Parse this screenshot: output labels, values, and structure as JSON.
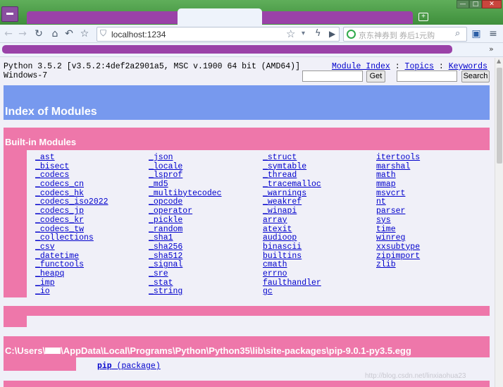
{
  "browser": {
    "new_tab": "+",
    "window_buttons": {
      "minimize": "—",
      "maximize": "□",
      "close": "✕"
    },
    "nav_icons": {
      "back": "←",
      "forward": "→",
      "reload": "↻",
      "home": "⌂",
      "undo": "↶",
      "favorite": "☆"
    },
    "address": {
      "url": "localhost:1234",
      "shield_icon": "⛉"
    },
    "address_icons": {
      "bookmark": "☆",
      "dropdown": "▾",
      "lightning": "ϟ",
      "play": "▶"
    },
    "search": {
      "placeholder": "京东神券到 券后1元购",
      "glass_icon": "⌕"
    },
    "extension_icon": "▣",
    "menu_icon": "≡",
    "bookmarks_more": "»",
    "scroll_up": "▲"
  },
  "header": {
    "version_line_1": "Python 3.5.2 [v3.5.2:4def2a2901a5, MSC v.1900 64 bit (AMD64)]",
    "version_line_2": "Windows-7",
    "links": {
      "module_index": "Module Index",
      "topics": "Topics",
      "keywords": "Keywords",
      "separator": " : "
    },
    "get_button": "Get",
    "search_button": "Search"
  },
  "index_title": "Index of Modules",
  "builtin": {
    "title": "Built-in Modules",
    "columns": [
      [
        "_ast",
        "_bisect",
        "_codecs",
        "_codecs_cn",
        "_codecs_hk",
        "_codecs_iso2022",
        "_codecs_jp",
        "_codecs_kr",
        "_codecs_tw",
        "_collections",
        "_csv",
        "_datetime",
        "_functools",
        "_heapq",
        "_imp",
        "_io"
      ],
      [
        "_json",
        "_locale",
        "_lsprof",
        "_md5",
        "_multibytecodec",
        "_opcode",
        "_operator",
        "_pickle",
        "_random",
        "_sha1",
        "_sha256",
        "_sha512",
        "_signal",
        "_sre",
        "_stat",
        "_string"
      ],
      [
        "_struct",
        "_symtable",
        "_thread",
        "_tracemalloc",
        "_warnings",
        "_weakref",
        "_winapi",
        "array",
        "atexit",
        "audioop",
        "binascii",
        "builtins",
        "cmath",
        "errno",
        "faulthandler",
        "gc"
      ],
      [
        "itertools",
        "marshal",
        "math",
        "mmap",
        "msvcrt",
        "nt",
        "parser",
        "sys",
        "time",
        "winreg",
        "xxsubtype",
        "zipimport",
        "zlib"
      ]
    ]
  },
  "site_packages": {
    "path_prefix": "C:\\Users\\",
    "path_suffix": "\\AppData\\Local\\Programs\\Python\\Python35\\lib\\site-packages\\pip-9.0.1-py3.5.egg",
    "package_link": "pip",
    "package_suffix": " (package)"
  },
  "watermark": "http://blog.csdn.net/linxiaohua23",
  "colors": {
    "index_banner": "#7799ee",
    "section_banner": "#ee77aa",
    "page_background": "#f0f0f8",
    "link": "#0000cc"
  }
}
